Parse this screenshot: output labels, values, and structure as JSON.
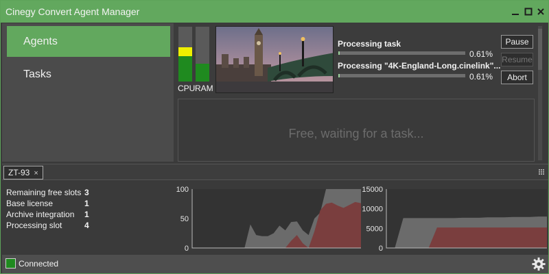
{
  "window": {
    "title": "Cinegy Convert Agent Manager"
  },
  "sidebar": {
    "items": [
      {
        "label": "Agents",
        "active": true
      },
      {
        "label": "Tasks",
        "active": false
      }
    ]
  },
  "agent": {
    "meters": {
      "cpu": {
        "label": "CPU",
        "level": 0.62,
        "color_low": "#1f8a1f",
        "color_high": "#f0f000"
      },
      "ram": {
        "label": "RAM",
        "level": 0.33,
        "color": "#1f8a1f"
      }
    },
    "tasks": [
      {
        "title": "Processing task",
        "percent_text": "0.61%",
        "progress": 0.0061
      },
      {
        "title": "Processing \"4K-England-Long.cinelink\"...",
        "percent_text": "0.61%",
        "progress": 0.0061
      }
    ],
    "buttons": {
      "pause": "Pause",
      "resume": "Resume",
      "abort": "Abort"
    },
    "waiting_text": "Free, waiting for a task..."
  },
  "tab": {
    "label": "ZT-93",
    "close": "×"
  },
  "details": {
    "items": [
      {
        "label": "Remaining free slots",
        "value": "3"
      },
      {
        "label": "Base license",
        "value": "1"
      },
      {
        "label": "Archive integration",
        "value": "1"
      },
      {
        "label": "Processing slot",
        "value": "4"
      }
    ]
  },
  "chart_data": [
    {
      "type": "area",
      "ylim": [
        0,
        100
      ],
      "yticks": [
        "100",
        "50",
        "0"
      ],
      "x": [
        0,
        1,
        2,
        3,
        4,
        5,
        6,
        7,
        8,
        9,
        10,
        11,
        12,
        13,
        14,
        15,
        16,
        17,
        18,
        19,
        20,
        21,
        22,
        23,
        24,
        25,
        26,
        27,
        28,
        29
      ],
      "series": [
        {
          "color": "#6b6b6b",
          "values": [
            0,
            0,
            0,
            0,
            0,
            0,
            0,
            0,
            0,
            0,
            40,
            22,
            20,
            20,
            25,
            38,
            30,
            44,
            45,
            30,
            22,
            50,
            60,
            100,
            100,
            100,
            100,
            100,
            100,
            100
          ]
        },
        {
          "color": "#7a3e3e",
          "values": [
            0,
            0,
            0,
            0,
            0,
            0,
            0,
            0,
            0,
            0,
            0,
            0,
            0,
            0,
            0,
            0,
            0,
            12,
            22,
            8,
            0,
            28,
            64,
            75,
            77,
            72,
            68,
            73,
            78,
            76
          ]
        }
      ]
    },
    {
      "type": "area",
      "ylim": [
        0,
        15000
      ],
      "yticks": [
        "15000",
        "10000",
        "5000",
        "0"
      ],
      "x": [
        0,
        1,
        2,
        3,
        4,
        5,
        6,
        7,
        8,
        9,
        10,
        11,
        12,
        13,
        14,
        15,
        16,
        17,
        18,
        19
      ],
      "series": [
        {
          "color": "#6b6b6b",
          "values": [
            0,
            0,
            7600,
            7600,
            7600,
            7600,
            7600,
            7600,
            7600,
            7700,
            7700,
            7700,
            7800,
            7800,
            7800,
            7900,
            7900,
            7900,
            8000,
            8000
          ]
        },
        {
          "color": "#7a3e3e",
          "values": [
            0,
            0,
            0,
            0,
            0,
            0,
            5200,
            5200,
            5200,
            5200,
            5200,
            5200,
            5200,
            5200,
            5200,
            5200,
            5200,
            5200,
            5200,
            5200
          ]
        }
      ]
    }
  ],
  "status": {
    "text": "Connected",
    "color": "#1f8a1f"
  },
  "icons": {
    "minimize": "minimize-icon",
    "maximize": "maximize-icon",
    "close": "close-icon",
    "settings": "gear-icon",
    "grip": "grip-icon"
  }
}
